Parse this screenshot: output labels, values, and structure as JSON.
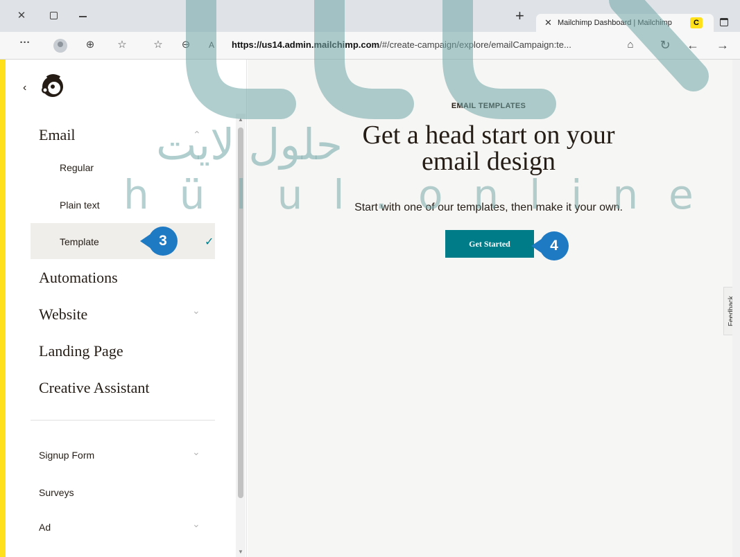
{
  "browser": {
    "tab_title": "Mailchimp Dashboard | Mailchimp",
    "tab_favicon": "C",
    "url_host": "https://us14.admin.mailchimp.com",
    "url_path": "/#/create-campaign/explore/emailCampaign:te...",
    "icons": [
      "close-icon",
      "tab-actions-icon",
      "minimize-icon",
      "new-tab-icon",
      "more-icon",
      "profile-icon",
      "collections-icon",
      "favorites-icon",
      "add-favorite-icon",
      "zoom-icon",
      "read-aloud-icon",
      "lock-icon",
      "refresh-icon",
      "back-icon",
      "forward-icon"
    ]
  },
  "sidebar": {
    "email_label": "Email",
    "email_items": [
      {
        "label": "Regular"
      },
      {
        "label": "Plain text"
      },
      {
        "label": "Template"
      }
    ],
    "items": [
      {
        "label": "Automations"
      },
      {
        "label": "Website"
      },
      {
        "label": "Landing Page"
      },
      {
        "label": "Creative Assistant"
      }
    ],
    "secondary": [
      {
        "label": "Signup Form"
      },
      {
        "label": "Surveys"
      },
      {
        "label": "Ad"
      }
    ]
  },
  "main": {
    "eyebrow": "EMAIL TEMPLATES",
    "headline_line1": "Get a head start on your",
    "headline_line2": "email design",
    "subtext": "Start with one of our templates, then make it your own.",
    "cta_label": "Get Started",
    "feedback_label": "Feedback"
  },
  "callouts": [
    {
      "number": "3"
    },
    {
      "number": "4"
    }
  ],
  "watermark": {
    "arabic": "حلول لايت",
    "latin": "hülul.online"
  },
  "colors": {
    "accent_teal": "#007c89",
    "mailchimp_yellow": "#ffe01b",
    "callout_blue": "#1f7ac4",
    "watermark": "#6fa6a6"
  }
}
